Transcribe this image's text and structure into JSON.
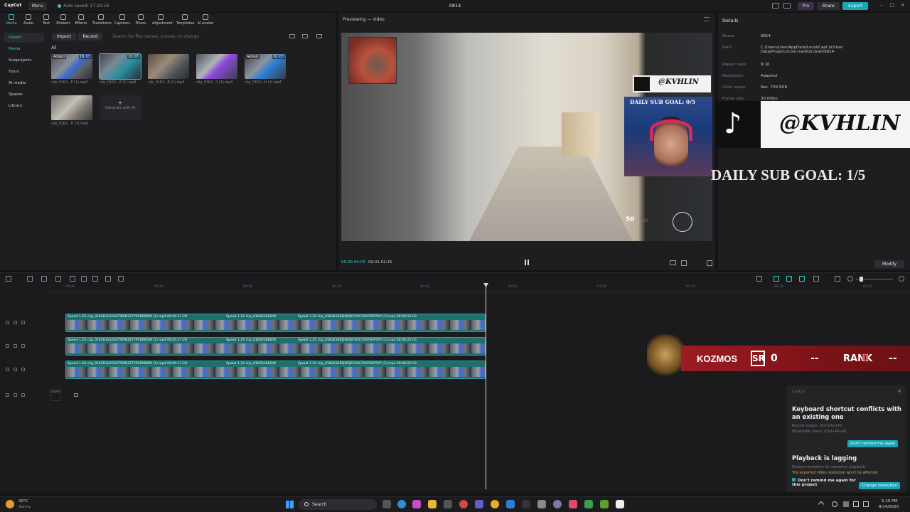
{
  "app": {
    "name": "CapCut",
    "menu_label": "Menu",
    "autosave": "Auto saved: 17:10:16",
    "project": "0814"
  },
  "titlebar": {
    "pro": "Pro",
    "share": "Share",
    "export": "Export"
  },
  "toolbar": [
    {
      "label": "Media",
      "icon": "media-icon"
    },
    {
      "label": "Audio",
      "icon": "audio-icon"
    },
    {
      "label": "Text",
      "icon": "text-icon"
    },
    {
      "label": "Stickers",
      "icon": "stickers-icon"
    },
    {
      "label": "Effects",
      "icon": "effects-icon"
    },
    {
      "label": "Transitions",
      "icon": "transitions-icon"
    },
    {
      "label": "Captions",
      "icon": "captions-icon"
    },
    {
      "label": "Filters",
      "icon": "filters-icon"
    },
    {
      "label": "Adjustment",
      "icon": "adjustment-icon"
    },
    {
      "label": "Templates",
      "icon": "templates-icon"
    },
    {
      "label": "AI avatar",
      "icon": "ai-avatar-icon"
    }
  ],
  "sidebar": [
    "Import",
    "Media",
    "Subprojects",
    "Yours",
    "AI media",
    "Spaces",
    "Library"
  ],
  "media": {
    "import": "Import",
    "record": "Record",
    "search_placeholder": "Search for file names, scenes, or dialogs",
    "filter_all": "All",
    "generate_ai": "Generate with AI",
    "items": [
      {
        "name": "clip_01K2...P (1).mp4",
        "added": "Added",
        "duration": "01:03"
      },
      {
        "name": "clip_01K2...Z (1).mp4",
        "added": "",
        "duration": "01:03"
      },
      {
        "name": "clip_01K2...8 (2).mp4",
        "added": "",
        "duration": ""
      },
      {
        "name": "clip_01K2...1 (1).mp4",
        "added": "",
        "duration": ""
      },
      {
        "name": "clip_01K2...H (1).mp4",
        "added": "Added",
        "duration": "01:03"
      },
      {
        "name": "clip_01K2...H (1).mp4",
        "added": "",
        "duration": ""
      }
    ]
  },
  "preview": {
    "title": "Previewing — video",
    "time_current": "00:00:04:03",
    "time_total": "00:01:02:15",
    "overlay_handle": "@KVHLIN",
    "overlay_goal": "DAILY SUB GOAL: 0/5",
    "hud_score": "50",
    "hud_score_max": "210"
  },
  "details": {
    "title": "Details",
    "rows": [
      {
        "key": "Name:",
        "value": "0814"
      },
      {
        "key": "Path:",
        "value": "C:/Users/User/AppData/Local/CapCut/User Data/Projects/com.lveditor.draft/0814"
      },
      {
        "key": "Aspect ratio:",
        "value": "9:16"
      },
      {
        "key": "Resolution:",
        "value": "Adapted"
      },
      {
        "key": "Color space:",
        "value": "Rec. 709 SDR"
      },
      {
        "key": "Frame rate:",
        "value": "30.00fps"
      }
    ],
    "modify": "Modify"
  },
  "stream_overlay": {
    "handle": "@KVHLIN",
    "goal": "DAILY SUB GOAL: 1/5"
  },
  "timeline": {
    "ticks": [
      "00:00",
      "00:10",
      "00:20",
      "00:30",
      "00:40",
      "00:50",
      "01:00",
      "01:10",
      "01:20",
      "01:30"
    ],
    "tracks": [
      {
        "seg1": "Speed 1.2X  clip_01K2K3V32GXTBRN3Z7YPSDM85M (1).mp4  00:00:17:29",
        "seg2": "Speed 1.2X  clip_01K2K3EBQW",
        "seg3": "Speed 1.2X  clip_01K2K3EBQWQ6YS0X7XVP3RP5YP (1).mp4  00:00:22:03"
      },
      {
        "seg1": "Speed 1.2X  clip_01K2K3V32GXTBRN3Z7YPSDM85M (1).mp4  00:00:17:29",
        "seg2": "Speed 1.2X  clip_01K2K3EBQW",
        "seg3": "Speed 1.2X  clip_01K2K3EBQWQ6YS0X7XVP3RP5YP (1).mp4  00:00:22:03"
      },
      {
        "seg1": "Speed 1.2X  clip_01K2K3V32GXTBRN3Z7YPSDM85M (1).mp4  00:00:17:29",
        "seg2": "Speed 1.2X  clip_01K2K3EBQW",
        "seg3": "Speed 1.2X  clip_01K2K3EBQWQ6YS0X7XVP3RP5YP (1).mp4  00:00:22:03"
      }
    ],
    "cover": "Cover"
  },
  "game_hud": {
    "name": "KOZMOS",
    "sr_label": "SR",
    "sr_value": "0",
    "dash1": "--",
    "rank_label": "RANK",
    "rank_value": "0",
    "dash2": "--"
  },
  "notification": {
    "source": "CapCut",
    "title1": "Keyboard shortcut conflicts with an existing one",
    "sub1a": "Record screen: [Ctrl+Alt+P]",
    "sub1b": "Show/hide rulers: [Ctrl+Alt+R]",
    "btn1": "Don't remind me again",
    "title2": "Playback is lagging",
    "sub2": "Reduce resolution for smoother playback.",
    "warn2": "The exported video resolution won't be affected.",
    "check": "Don't remind me again for this project",
    "btn2": "Change resolution"
  },
  "taskbar": {
    "temp": "42°C",
    "weather": "Sunny",
    "search": "Search",
    "time": "5:10 PM",
    "date": "8/14/2025"
  },
  "colors": {
    "accent": "#36c8d8",
    "export": "#1aa7b8",
    "clip": "#1f6f6d"
  }
}
